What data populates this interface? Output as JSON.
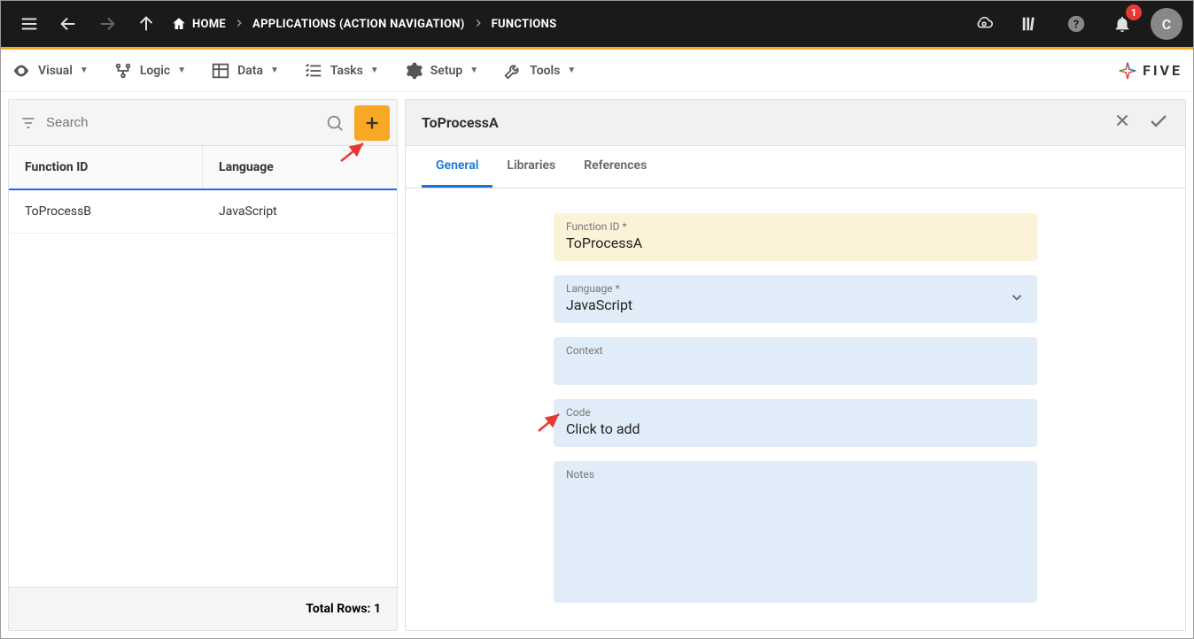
{
  "topbar": {
    "breadcrumb": [
      {
        "label": "HOME",
        "icon": "home"
      },
      {
        "label": "APPLICATIONS (ACTION NAVIGATION)"
      },
      {
        "label": "FUNCTIONS"
      }
    ],
    "notif_count": "1",
    "avatar_letter": "C"
  },
  "menubar": {
    "items": [
      {
        "label": "Visual",
        "icon": "eye"
      },
      {
        "label": "Logic",
        "icon": "logic"
      },
      {
        "label": "Data",
        "icon": "table"
      },
      {
        "label": "Tasks",
        "icon": "tasks"
      },
      {
        "label": "Setup",
        "icon": "gear"
      },
      {
        "label": "Tools",
        "icon": "tools"
      }
    ],
    "logo_text": "FIVE"
  },
  "left_panel": {
    "search_placeholder": "Search",
    "columns": {
      "col1": "Function ID",
      "col2": "Language"
    },
    "rows": [
      {
        "id": "ToProcessB",
        "lang": "JavaScript"
      }
    ],
    "footer": "Total Rows: 1"
  },
  "right_panel": {
    "title": "ToProcessA",
    "tabs": [
      {
        "label": "General",
        "active": true
      },
      {
        "label": "Libraries",
        "active": false
      },
      {
        "label": "References",
        "active": false
      }
    ],
    "fields": {
      "function_id": {
        "label": "Function ID *",
        "value": "ToProcessA"
      },
      "language": {
        "label": "Language *",
        "value": "JavaScript"
      },
      "context": {
        "label": "Context",
        "value": ""
      },
      "code": {
        "label": "Code",
        "value": "Click to add"
      },
      "notes": {
        "label": "Notes",
        "value": ""
      }
    }
  }
}
